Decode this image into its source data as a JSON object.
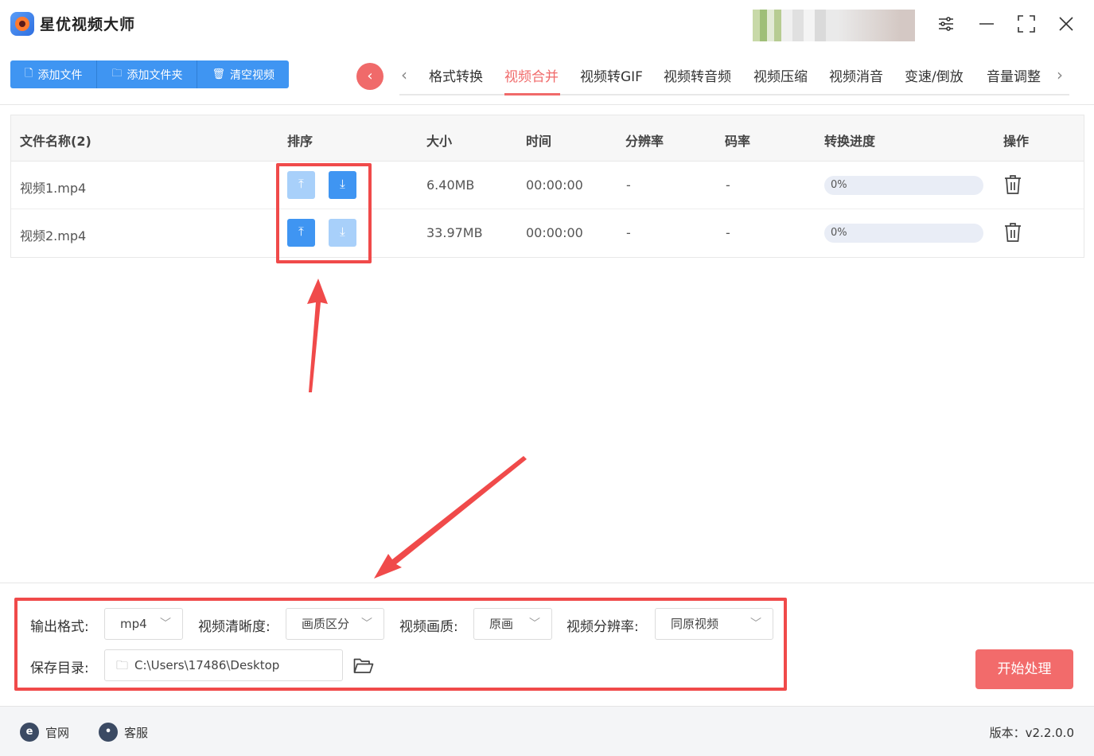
{
  "app": {
    "title": "星优视频大师"
  },
  "toolbar": {
    "buttons": [
      {
        "label": "添加文件",
        "icon": "file-icon"
      },
      {
        "label": "添加文件夹",
        "icon": "folder-icon"
      },
      {
        "label": "清空视频",
        "icon": "trash-icon"
      }
    ]
  },
  "tabs": [
    {
      "label": "格式转换",
      "active": false
    },
    {
      "label": "视频合并",
      "active": true
    },
    {
      "label": "视频转GIF",
      "active": false
    },
    {
      "label": "视频转音频",
      "active": false
    },
    {
      "label": "视频压缩",
      "active": false
    },
    {
      "label": "视频消音",
      "active": false
    },
    {
      "label": "变速/倒放",
      "active": false
    },
    {
      "label": "音量调整",
      "active": false
    }
  ],
  "table": {
    "headers": [
      "文件名称(2)",
      "排序",
      "大小",
      "时间",
      "分辨率",
      "码率",
      "转换进度",
      "操作"
    ],
    "rows": [
      {
        "name": "视频1.mp4",
        "size": "6.40MB",
        "time": "00:00:00",
        "resolution": "-",
        "bitrate": "-",
        "progress": "0%",
        "up_enabled": false,
        "down_enabled": true
      },
      {
        "name": "视频2.mp4",
        "size": "33.97MB",
        "time": "00:00:00",
        "resolution": "-",
        "bitrate": "-",
        "progress": "0%",
        "up_enabled": true,
        "down_enabled": false
      }
    ]
  },
  "settings": {
    "format_label": "输出格式:",
    "format_value": "mp4",
    "clarity_label": "视频清晰度:",
    "clarity_value": "画质区分",
    "quality_label": "视频画质:",
    "quality_value": "原画",
    "resolution_label": "视频分辨率:",
    "resolution_value": "同原视频",
    "save_label": "保存目录:",
    "save_path": "C:\\Users\\17486\\Desktop",
    "start_label": "开始处理"
  },
  "statusbar": {
    "website": "官网",
    "service": "客服",
    "version": "版本：v2.2.0.0"
  },
  "colors": {
    "primary": "#3f95f2",
    "accent": "#f06a6a",
    "annotation": "#f04a4a"
  }
}
